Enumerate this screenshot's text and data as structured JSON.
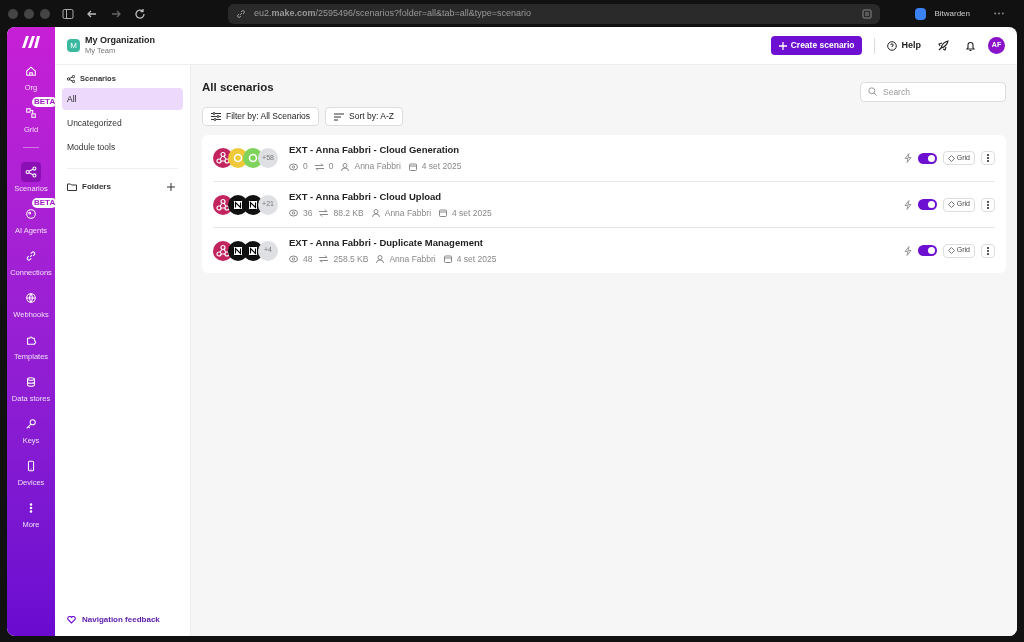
{
  "browser": {
    "url": "eu2.**make.com**/2595496/scenarios?folder=all&tab=all&type=scenario",
    "extension": "Bitwarden"
  },
  "header": {
    "org_initial": "M",
    "org": "My Organization",
    "team": "My Team",
    "create": "Create scenario",
    "help": "Help",
    "avatar": "AF"
  },
  "rail": [
    {
      "label": "Org",
      "selected": false
    },
    {
      "label": "Grid",
      "badge": "BETA",
      "selected": false
    },
    {
      "label": "Scenarios",
      "selected": true
    },
    {
      "label": "AI Agents",
      "badge": "BETA",
      "selected": false
    },
    {
      "label": "Connections",
      "selected": false
    },
    {
      "label": "Webhooks",
      "selected": false
    },
    {
      "label": "Templates",
      "selected": false
    },
    {
      "label": "Data stores",
      "selected": false
    },
    {
      "label": "Keys",
      "selected": false
    },
    {
      "label": "Devices",
      "selected": false
    },
    {
      "label": "More",
      "selected": false
    }
  ],
  "sidebar": {
    "heading": "Scenarios",
    "items": [
      {
        "label": "All",
        "selected": true
      },
      {
        "label": "Uncategorized",
        "selected": false
      },
      {
        "label": "Module tools",
        "selected": false
      }
    ],
    "folders": "Folders",
    "feedback": "Navigation feedback"
  },
  "main": {
    "title": "All scenarios",
    "search": {
      "placeholder": "Search"
    },
    "filter": "Filter by: All Scenarios",
    "sort": "Sort by: A-Z"
  },
  "scenarios": [
    {
      "name": "EXT - Anna Fabbri - Cloud Generation",
      "apps": [
        {
          "kind": "webhook",
          "color": "#c1245f"
        },
        {
          "kind": "app",
          "color": "#f0c93a"
        },
        {
          "kind": "app",
          "color": "#7ed35a"
        }
      ],
      "more": "+58",
      "ops": "0",
      "data": "0",
      "owner": "Anna Fabbri",
      "date": "4 set 2025",
      "on": true,
      "grid": "Grid"
    },
    {
      "name": "EXT - Anna Fabbri - Cloud Upload",
      "apps": [
        {
          "kind": "webhook",
          "color": "#c1245f"
        },
        {
          "kind": "notion",
          "color": "#111111"
        },
        {
          "kind": "notion",
          "color": "#111111"
        }
      ],
      "more": "+21",
      "ops": "36",
      "data": "88.2 KB",
      "owner": "Anna Fabbri",
      "date": "4 set 2025",
      "on": true,
      "grid": "Grid"
    },
    {
      "name": "EXT - Anna Fabbri - Duplicate Management",
      "apps": [
        {
          "kind": "webhook",
          "color": "#c1245f"
        },
        {
          "kind": "notion",
          "color": "#111111"
        },
        {
          "kind": "notion",
          "color": "#111111"
        }
      ],
      "more": "+4",
      "ops": "48",
      "data": "258.5 KB",
      "owner": "Anna Fabbri",
      "date": "4 set 2025",
      "on": true,
      "grid": "Grid"
    }
  ]
}
